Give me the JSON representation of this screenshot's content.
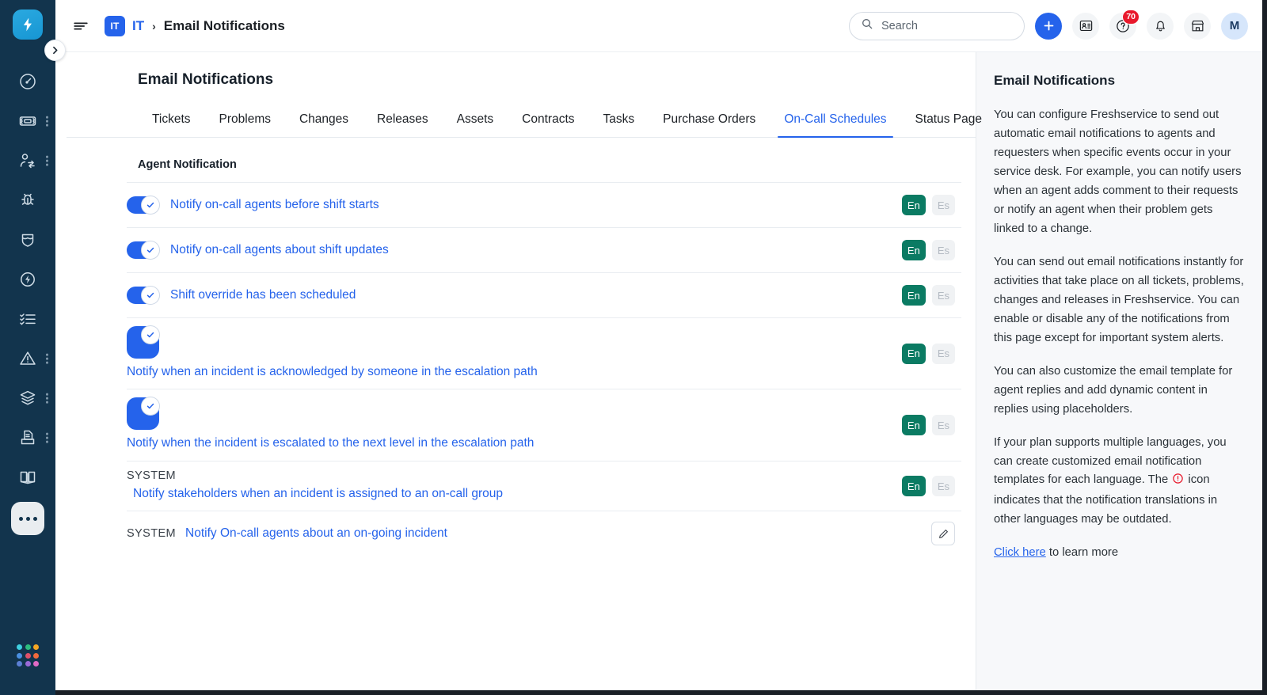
{
  "window": {
    "title": "Email Notifications"
  },
  "sidebar": {
    "brand_icon": "freshservice-bolt-logo",
    "collapse_icon": "chevron-right-icon",
    "items": [
      {
        "name": "dashboard",
        "icon": "speedometer-icon",
        "kebab": false
      },
      {
        "name": "tickets",
        "icon": "ticket-icon",
        "kebab": true
      },
      {
        "name": "requesters",
        "icon": "user-swap-icon",
        "kebab": true
      },
      {
        "name": "problems",
        "icon": "bug-icon",
        "kebab": false
      },
      {
        "name": "changes",
        "icon": "shield-icon",
        "kebab": false
      },
      {
        "name": "releases",
        "icon": "lightning-circle-icon",
        "kebab": false
      },
      {
        "name": "tasks",
        "icon": "checklist-icon",
        "kebab": false
      },
      {
        "name": "alerts",
        "icon": "warning-triangle-icon",
        "kebab": true
      },
      {
        "name": "assets",
        "icon": "layers-icon",
        "kebab": true
      },
      {
        "name": "contracts",
        "icon": "document-tray-icon",
        "kebab": true
      },
      {
        "name": "solutions",
        "icon": "open-book-icon",
        "kebab": false
      }
    ],
    "more_label": "more-options",
    "switcher_colors": [
      "#3fd0e0",
      "#2dbe7e",
      "#f5a623",
      "#4a90e2",
      "#e0506a",
      "#f06a3c",
      "#5b7fd4",
      "#9b6ad8",
      "#e06ac5"
    ]
  },
  "header": {
    "menu_icon": "hamburger-icon",
    "workspace_badge": "IT",
    "breadcrumb_link": "IT",
    "breadcrumb_separator": "›",
    "breadcrumb_current": "Email Notifications",
    "search": {
      "icon": "search-icon",
      "placeholder": "Search",
      "value": ""
    },
    "add_button_icon": "plus-icon",
    "contacts_icon": "contact-card-icon",
    "help_icon": "help-question-icon",
    "help_badge": "70",
    "notifications_icon": "bell-icon",
    "marketplace_icon": "marketplace-shop-icon",
    "avatar_initial": "M"
  },
  "main": {
    "page_title": "Email Notifications",
    "tabs": [
      {
        "label": "Tickets",
        "active": false
      },
      {
        "label": "Problems",
        "active": false
      },
      {
        "label": "Changes",
        "active": false
      },
      {
        "label": "Releases",
        "active": false
      },
      {
        "label": "Assets",
        "active": false
      },
      {
        "label": "Contracts",
        "active": false
      },
      {
        "label": "Tasks",
        "active": false
      },
      {
        "label": "Purchase Orders",
        "active": false
      },
      {
        "label": "On-Call Schedules",
        "active": true
      },
      {
        "label": "Status Page",
        "active": false
      }
    ],
    "section_title": "Agent Notification",
    "lang_on_label": "En",
    "lang_off_label": "Es",
    "system_tag": "SYSTEM",
    "edit_icon": "pencil-edit-icon",
    "rows": [
      {
        "label": "Notify on-call agents before shift starts",
        "toggle": true,
        "layout": "inline",
        "system": false,
        "langs": true,
        "edit": false
      },
      {
        "label": "Notify on-call agents about shift updates",
        "toggle": true,
        "layout": "inline",
        "system": false,
        "langs": true,
        "edit": false
      },
      {
        "label": "Shift override has been scheduled",
        "toggle": true,
        "layout": "inline",
        "system": false,
        "langs": true,
        "edit": false
      },
      {
        "label": "Notify when an incident is acknowledged by someone in the escalation path",
        "toggle": true,
        "layout": "stacked",
        "system": false,
        "langs": true,
        "edit": false
      },
      {
        "label": "Notify when the incident is escalated to the next level in the escalation path",
        "toggle": true,
        "layout": "stacked",
        "system": false,
        "langs": true,
        "edit": false
      },
      {
        "label": "Notify stakeholders when an incident is assigned to an on-call group",
        "toggle": false,
        "layout": "system-stacked",
        "system": true,
        "langs": true,
        "edit": false
      },
      {
        "label": "Notify On-call agents about an on-going incident",
        "toggle": false,
        "layout": "system-inline",
        "system": true,
        "langs": false,
        "edit": true
      }
    ]
  },
  "info_panel": {
    "title": "Email Notifications",
    "paragraphs": [
      "You can configure Freshservice to send out automatic email notifications to agents and requesters when specific events occur in your service desk. For example, you can notify users when an agent adds comment to their requests or notify an agent when their problem gets linked to a change.",
      "You can send out email notifications instantly for activities that take place on all tickets, problems, changes and releases in Freshservice. You can enable or disable any of the notifications from this page except for important system alerts.",
      "You can also customize the email template for agent replies and add dynamic content in replies using placeholders."
    ],
    "warn_paragraph_before": "If your plan supports multiple languages, you can create customized email notification templates for each language. The ",
    "warn_icon": "red-exclamation-circle-icon",
    "warn_paragraph_after": " icon indicates that the notification translations in other languages may be outdated.",
    "link_text": "Click here",
    "link_suffix": " to learn more"
  },
  "colors": {
    "sidebar_bg": "#12344d",
    "accent_blue": "#2563eb",
    "lang_on_green": "#0b7b63",
    "badge_red": "#e8192c",
    "panel_bg": "#f7f8fa"
  }
}
